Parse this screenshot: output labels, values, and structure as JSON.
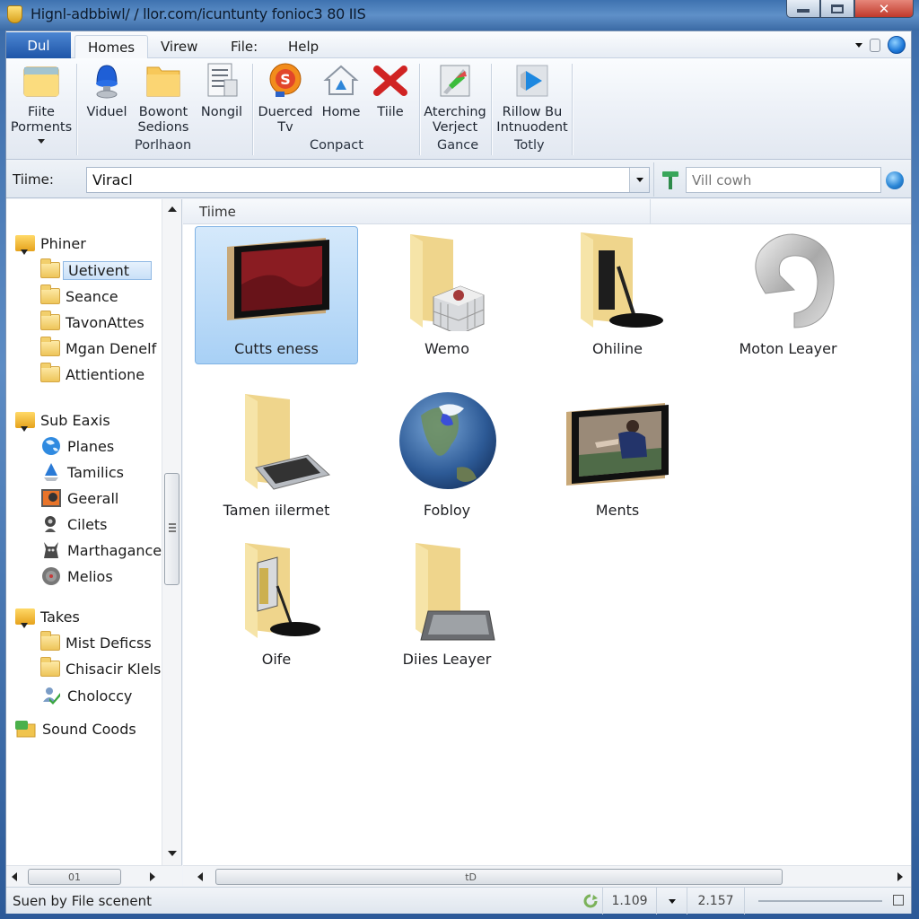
{
  "window": {
    "title": "Hignl-adbbiwl/ / llor.com/icuntunty fonioc3 80 IIS",
    "controls": {
      "minimize": "minimize",
      "maximize": "maximize",
      "close": "✕"
    }
  },
  "menubar": {
    "file_tab": "Dul",
    "tabs": [
      {
        "label": "Homes",
        "active": true
      },
      {
        "label": "Virew",
        "active": false
      },
      {
        "label": "File:",
        "active": false
      },
      {
        "label": "Help",
        "active": false
      }
    ]
  },
  "ribbon": {
    "groups": [
      {
        "label": "",
        "buttons": [
          {
            "label": "Fiite\nPorments",
            "icon": "folder-icon",
            "has_dropdown": true
          }
        ]
      },
      {
        "label": "Porlhaon",
        "buttons": [
          {
            "label": "Viduel",
            "icon": "lamp-icon"
          },
          {
            "label": "Bowont\nSedions",
            "icon": "folder-icon"
          },
          {
            "label": "Nongil",
            "icon": "document-icon"
          }
        ]
      },
      {
        "label": "Conpact",
        "buttons": [
          {
            "label": "Duerced\nTv",
            "icon": "badge-icon"
          },
          {
            "label": "Home",
            "icon": "home-icon"
          },
          {
            "label": "Tiile",
            "icon": "delete-icon"
          }
        ]
      },
      {
        "label": "Gance",
        "buttons": [
          {
            "label": "Aterching\nVerject",
            "icon": "image-edit-icon"
          }
        ]
      },
      {
        "label": "Totly",
        "buttons": [
          {
            "label": "Rillow Bu\nIntnuodent",
            "icon": "play-icon"
          }
        ]
      }
    ]
  },
  "addressbar": {
    "label": "Tiime:",
    "value": "Viracl",
    "search_placeholder": "Vill cowh"
  },
  "navpane": {
    "sections": [
      {
        "label": "Phiner",
        "children": [
          {
            "label": "Uetivent",
            "icon": "folder-icon",
            "selected": true
          },
          {
            "label": "Seance",
            "icon": "folder-icon"
          },
          {
            "label": "TavonAttes",
            "icon": "folder-icon"
          },
          {
            "label": "Mgan Denelf",
            "icon": "folder-icon"
          },
          {
            "label": "Attientione",
            "icon": "folder-icon"
          }
        ]
      },
      {
        "label": "Sub Eaxis",
        "children": [
          {
            "label": "Planes",
            "icon": "globe-icon"
          },
          {
            "label": "Tamilics",
            "icon": "drop-icon"
          },
          {
            "label": "Geerall",
            "icon": "photo-icon"
          },
          {
            "label": "Cilets",
            "icon": "gear-person-icon"
          },
          {
            "label": "Marthagance",
            "icon": "creature-icon"
          },
          {
            "label": "Melios",
            "icon": "disc-icon"
          }
        ]
      },
      {
        "label": "Takes",
        "children": [
          {
            "label": "Mist Deficss",
            "icon": "folder-icon"
          },
          {
            "label": "Chisacir Klels",
            "icon": "folder-icon"
          },
          {
            "label": "Choloccy",
            "icon": "users-icon"
          }
        ]
      },
      {
        "label": "Sound Coods",
        "icon": "network-folder-icon",
        "children": []
      }
    ],
    "hscroll_label": "01"
  },
  "content": {
    "column_header": "Tiime",
    "items": [
      {
        "label": "Cutts eness",
        "icon": "picture-frame-red-icon",
        "selected": true
      },
      {
        "label": "Wemo",
        "icon": "folder-cube-icon"
      },
      {
        "label": "Ohiline",
        "icon": "folder-microphone-icon"
      },
      {
        "label": "Moton Leayer",
        "icon": "silver-loop-icon"
      },
      {
        "label": "Tamen iilermet",
        "icon": "folder-tablet-icon"
      },
      {
        "label": "Fobloy",
        "icon": "globe-icon"
      },
      {
        "label": "Ments",
        "icon": "picture-frame-photo-icon"
      },
      {
        "label": "Oife",
        "icon": "folder-microphone-icon"
      },
      {
        "label": "Diies Leayer",
        "icon": "folder-tablet-icon"
      }
    ],
    "hscroll_label": "tD"
  },
  "statusbar": {
    "text": "Suen by File scenent",
    "value_1": "1.109",
    "value_2": "2.157"
  }
}
